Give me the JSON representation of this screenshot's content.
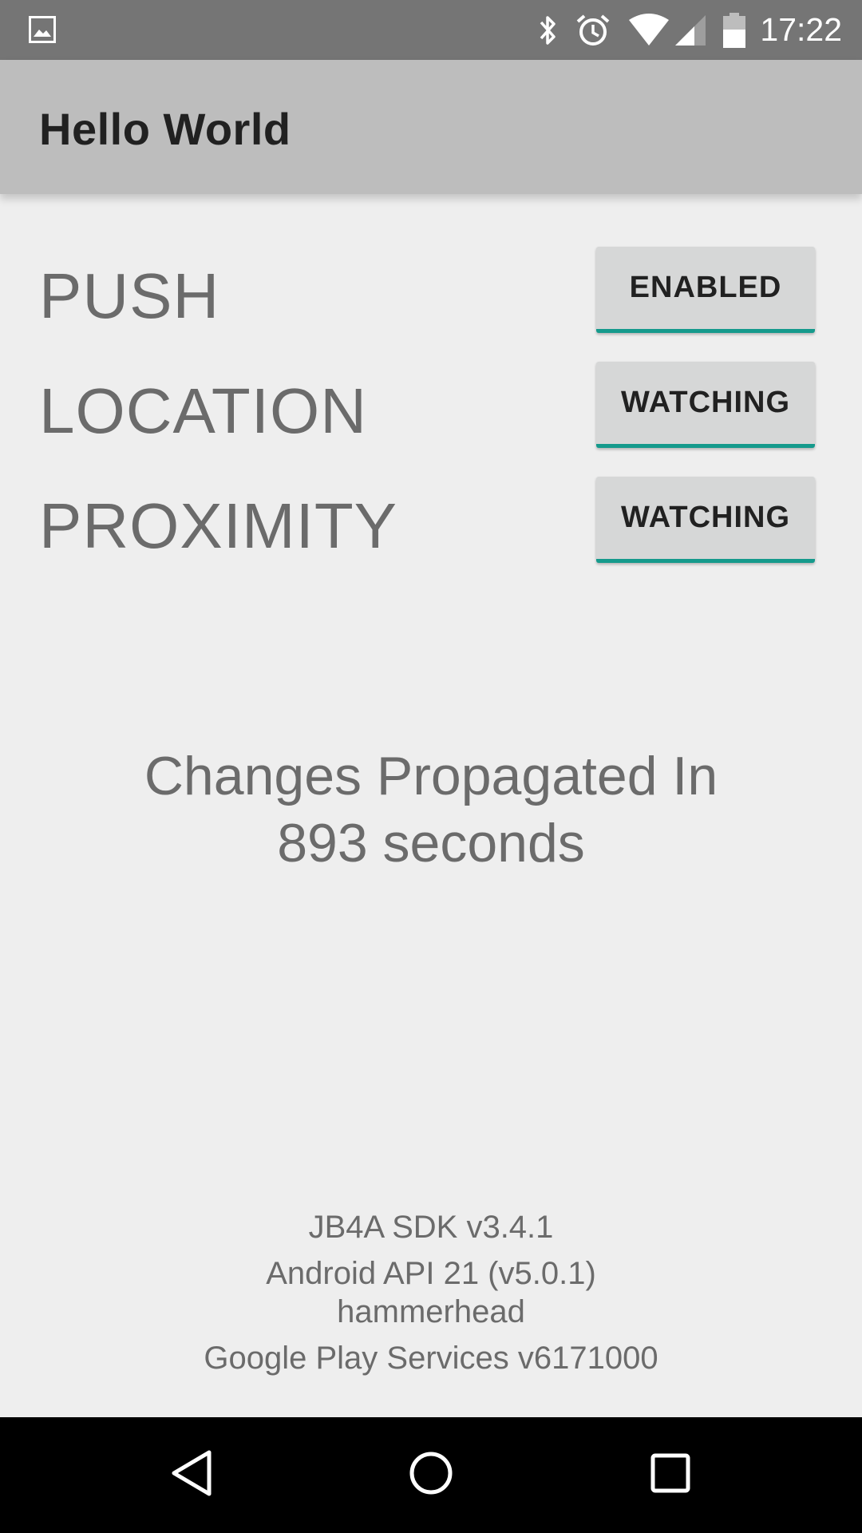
{
  "status_bar": {
    "time": "17:22",
    "icons": [
      "gallery-notification-icon",
      "bluetooth-icon",
      "alarm-icon",
      "wifi-icon",
      "cell-signal-icon",
      "battery-icon"
    ],
    "background": "#757575"
  },
  "app_bar": {
    "title": "Hello World",
    "background": "#bdbdbd"
  },
  "rows": [
    {
      "label": "PUSH",
      "button": "ENABLED"
    },
    {
      "label": "LOCATION",
      "button": "WATCHING"
    },
    {
      "label": "PROXIMITY",
      "button": "WATCHING"
    }
  ],
  "propagation": {
    "line1": "Changes Propagated In",
    "line2": "893 seconds"
  },
  "footer": {
    "sdk": "JB4A SDK v3.4.1",
    "android": "Android API 21 (v5.0.1)",
    "device": "hammerhead",
    "play_services": "Google Play Services v6171000"
  },
  "nav_bar": {
    "icons": [
      "back-icon",
      "home-icon",
      "recents-icon"
    ]
  },
  "colors": {
    "accent": "#159a8c",
    "button_bg": "#d6d7d7",
    "text_gray": "#6b6b6b"
  }
}
